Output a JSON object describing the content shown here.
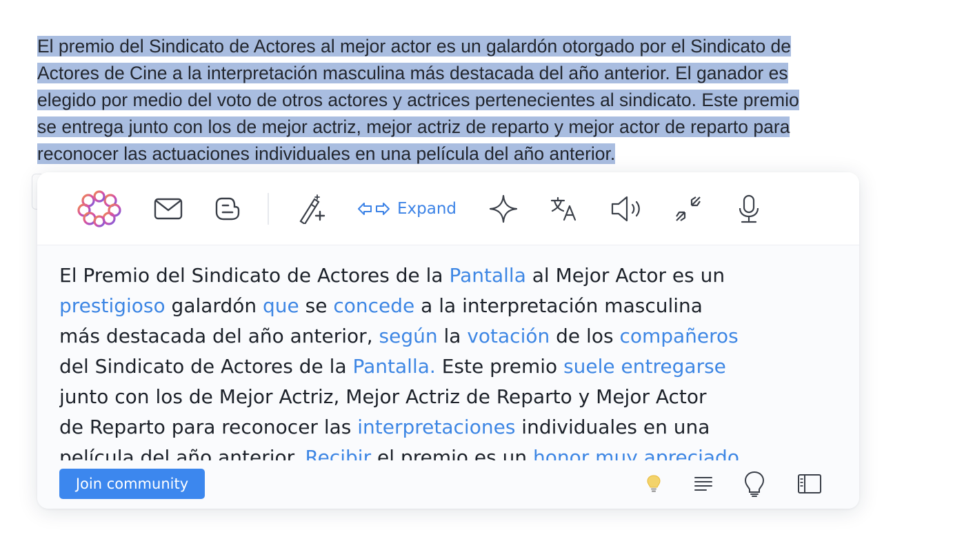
{
  "source": {
    "lines": [
      "El premio del Sindicato de Actores al mejor actor es un galardón otorgado por el Sindicato de",
      "Actores de Cine a la interpretación masculina más destacada del año anterior. El ganador es",
      "elegido por medio del voto de otros actores y actrices pertenecientes al sindicato. Este premio",
      "se entrega junto con los de mejor actriz, mejor actriz de reparto y mejor actor de reparto para",
      "reconocer las actuaciones individuales en una película del año anterior."
    ]
  },
  "colors": {
    "selection": "#a9bde0",
    "accent": "#3b82e6",
    "highlight_word": "#3d86e4",
    "join_button": "#3c87ee",
    "bulb": "#f3d36b"
  },
  "toolbar": {
    "items": [
      {
        "icon": "brain-logo-icon"
      },
      {
        "icon": "mail-icon"
      },
      {
        "icon": "blogger-icon"
      },
      {
        "icon": "magic-wand-icon"
      },
      {
        "icon": "expand-arrows-icon"
      },
      {
        "icon": "sparkle-icon"
      },
      {
        "icon": "translate-icon"
      },
      {
        "icon": "speaker-icon"
      },
      {
        "icon": "shrink-arrows-icon"
      },
      {
        "icon": "microphone-icon"
      }
    ],
    "expand_label": "Expand"
  },
  "result": {
    "lines": [
      [
        {
          "t": "El Premio del Sindicato de Actores de la "
        },
        {
          "t": "Pantalla",
          "h": true
        },
        {
          "t": " al Mejor Actor es un"
        }
      ],
      [
        {
          "t": "prestigioso",
          "h": true
        },
        {
          "t": " galardón "
        },
        {
          "t": "que",
          "h": true
        },
        {
          "t": " se "
        },
        {
          "t": "concede",
          "h": true
        },
        {
          "t": " a la interpretación masculina"
        }
      ],
      [
        {
          "t": "más destacada del año anterior, "
        },
        {
          "t": "según",
          "h": true
        },
        {
          "t": " la "
        },
        {
          "t": "votación",
          "h": true
        },
        {
          "t": " de los "
        },
        {
          "t": "compañeros",
          "h": true
        }
      ],
      [
        {
          "t": "del Sindicato de Actores de la "
        },
        {
          "t": "Pantalla.",
          "h": true
        },
        {
          "t": " Este premio "
        },
        {
          "t": "suele entregarse",
          "h": true
        }
      ],
      [
        {
          "t": "junto con los de Mejor Actriz, Mejor Actriz de Reparto y Mejor Actor"
        }
      ],
      [
        {
          "t": "de Reparto para reconocer las "
        },
        {
          "t": "interpretaciones",
          "h": true
        },
        {
          "t": " individuales en una"
        }
      ],
      [
        {
          "t": "película del año anterior. "
        },
        {
          "t": "Recibir",
          "h": true
        },
        {
          "t": " el premio es un "
        },
        {
          "t": "honor muy apreciado",
          "h": true
        }
      ]
    ]
  },
  "footer": {
    "join_label": "Join community",
    "icons": [
      "lightbulb-icon",
      "text-align-icon",
      "bulb-outline-icon",
      "sidebar-panel-icon"
    ]
  }
}
